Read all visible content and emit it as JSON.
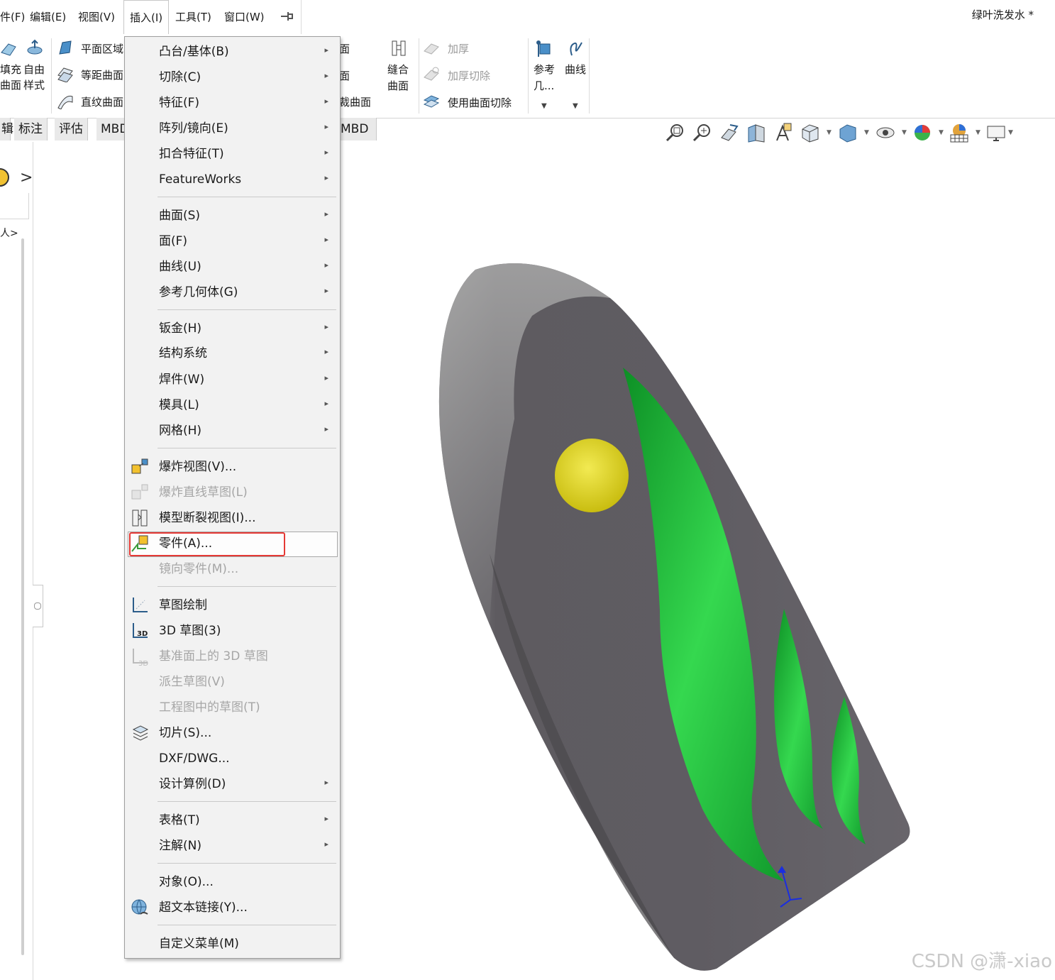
{
  "menubar": {
    "items": [
      "件(F)",
      "编辑(E)",
      "视图(V)",
      "插入(I)",
      "工具(T)",
      "窗口(W)"
    ],
    "document_title": "绿叶洗发水 *"
  },
  "ribbon": {
    "fill_surface": "填充\n曲面",
    "fill_surface_l1": "填充",
    "fill_surface_l2": "曲面",
    "freeform_l1": "自由",
    "freeform_l2": "样式",
    "planar": "平面区域",
    "offset": "等距曲面",
    "ruled": "直纹曲面",
    "hidden_1": "面",
    "hidden_2": "面",
    "trim": "裁曲面",
    "knit_l1": "缝合",
    "knit_l2": "曲面",
    "thicken": "加厚",
    "thicken_cut": "加厚切除",
    "surface_cut": "使用曲面切除",
    "ref_l1": "参考",
    "ref_l2": "几...",
    "curves": "曲线"
  },
  "tabs": [
    "辑",
    "标注",
    "评估",
    "MBD",
    "MBD"
  ],
  "left_panel": {
    "chevron": ">",
    "breadcrumb": "人>"
  },
  "insert_menu": {
    "items": [
      {
        "label": "凸台/基体(B)",
        "sub": true
      },
      {
        "label": "切除(C)",
        "sub": true
      },
      {
        "label": "特征(F)",
        "sub": true
      },
      {
        "label": "阵列/镜向(E)",
        "sub": true
      },
      {
        "label": "扣合特征(T)",
        "sub": true
      },
      {
        "label": "FeatureWorks",
        "sub": true
      },
      {
        "label": "曲面(S)",
        "sub": true
      },
      {
        "label": "面(F)",
        "sub": true
      },
      {
        "label": "曲线(U)",
        "sub": true
      },
      {
        "label": "参考几何体(G)",
        "sub": true
      },
      {
        "label": "钣金(H)",
        "sub": true
      },
      {
        "label": "结构系统",
        "sub": true
      },
      {
        "label": "焊件(W)",
        "sub": true
      },
      {
        "label": "模具(L)",
        "sub": true
      },
      {
        "label": "网格(H)",
        "sub": true
      },
      {
        "label": "爆炸视图(V)...",
        "sub": false
      },
      {
        "label": "爆炸直线草图(L)",
        "sub": false,
        "disabled": true
      },
      {
        "label": "模型断裂视图(I)...",
        "sub": false
      },
      {
        "label": "零件(A)...",
        "sub": false,
        "highlighted": true
      },
      {
        "label": "镜向零件(M)...",
        "sub": false,
        "disabled": true
      },
      {
        "label": "草图绘制",
        "sub": false
      },
      {
        "label": "3D 草图(3)",
        "sub": false
      },
      {
        "label": "基准面上的 3D 草图",
        "sub": false,
        "disabled": true
      },
      {
        "label": "派生草图(V)",
        "sub": false,
        "disabled": true
      },
      {
        "label": "工程图中的草图(T)",
        "sub": false,
        "disabled": true
      },
      {
        "label": "切片(S)...",
        "sub": false
      },
      {
        "label": "DXF/DWG...",
        "sub": false
      },
      {
        "label": "设计算例(D)",
        "sub": true
      },
      {
        "label": "表格(T)",
        "sub": true
      },
      {
        "label": "注解(N)",
        "sub": true
      },
      {
        "label": "对象(O)...",
        "sub": false
      },
      {
        "label": "超文本链接(Y)...",
        "sub": false
      },
      {
        "label": "自定义菜单(M)",
        "sub": false
      }
    ]
  },
  "viewport": {
    "body_color": "#5f5c62",
    "leaf_color": "#22c53a",
    "dot_color": "#e5dc22"
  },
  "colors": {
    "highlight_box": "#e53935",
    "axis": "#1a2ee0"
  },
  "watermark": "CSDN @潇-xiao"
}
